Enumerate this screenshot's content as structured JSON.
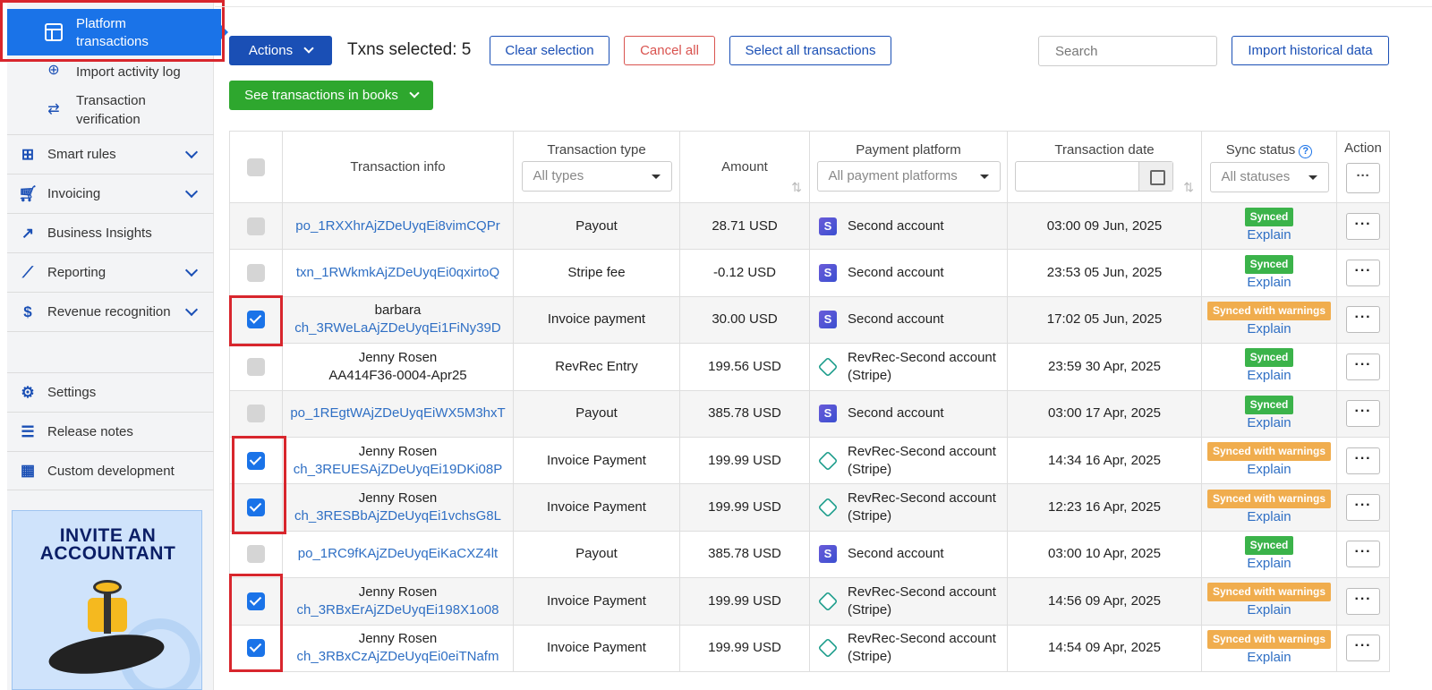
{
  "sidebar": {
    "active_item": {
      "label": "Platform transactions",
      "icon": "table-icon"
    },
    "sub_items": [
      {
        "label": "Import activity log",
        "icon": "download-circle-icon"
      },
      {
        "label": "Transaction verification",
        "icon": "arrows-exchange-icon"
      }
    ],
    "nav_items": [
      {
        "label": "Smart rules",
        "icon": "flow-icon",
        "expandable": true
      },
      {
        "label": "Invoicing",
        "icon": "cart-icon",
        "expandable": true
      },
      {
        "label": "Business Insights",
        "icon": "insights-icon",
        "expandable": false
      },
      {
        "label": "Reporting",
        "icon": "chart-line-icon",
        "expandable": true
      },
      {
        "label": "Revenue recognition",
        "icon": "dollar-icon",
        "expandable": true
      }
    ],
    "bottom_items": [
      {
        "label": "Settings",
        "icon": "gear-icon"
      },
      {
        "label": "Release notes",
        "icon": "notes-icon"
      },
      {
        "label": "Custom development",
        "icon": "grid-icon"
      }
    ],
    "promo": {
      "line1": "INVITE AN",
      "line2": "ACCOUNTANT"
    }
  },
  "toolbar": {
    "actions_label": "Actions",
    "selected_text": "Txns selected: 5",
    "clear_label": "Clear selection",
    "cancel_label": "Cancel all",
    "select_all_label": "Select all transactions",
    "search_placeholder": "Search",
    "import_label": "Import historical data",
    "books_label": "See transactions in books"
  },
  "table": {
    "headers": {
      "info": "Transaction info",
      "type": "Transaction type",
      "type_filter": "All types",
      "amount": "Amount",
      "platform": "Payment platform",
      "platform_filter": "All payment platforms",
      "date": "Transaction date",
      "sync": "Sync status",
      "sync_filter": "All statuses",
      "action": "Action"
    },
    "rows": [
      {
        "checked": false,
        "name": "",
        "id": "po_1RXXhrAjZDeUyqEi8vimCQPr",
        "type": "Payout",
        "amount": "28.71 USD",
        "platform_icon": "stripe-icon",
        "platform": "Second account",
        "date": "03:00 09 Jun, 2025",
        "status": "Synced",
        "status_kind": "ok",
        "explain": "Explain"
      },
      {
        "checked": false,
        "name": "",
        "id": "txn_1RWkmkAjZDeUyqEi0qxirtoQ",
        "type": "Stripe fee",
        "amount": "-0.12 USD",
        "platform_icon": "stripe-icon",
        "platform": "Second account",
        "date": "23:53 05 Jun, 2025",
        "status": "Synced",
        "status_kind": "ok",
        "explain": "Explain"
      },
      {
        "checked": true,
        "name": "barbara",
        "id": "ch_3RWeLaAjZDeUyqEi1FiNy39D",
        "type": "Invoice payment",
        "amount": "30.00 USD",
        "platform_icon": "stripe-icon",
        "platform": "Second account",
        "date": "17:02 05 Jun, 2025",
        "status": "Synced with warnings",
        "status_kind": "warn",
        "explain": "Explain"
      },
      {
        "checked": false,
        "name": "Jenny Rosen",
        "id": "AA414F36-0004-Apr25",
        "id_plain": true,
        "type": "RevRec Entry",
        "amount": "199.56 USD",
        "platform_icon": "revrec-icon",
        "platform": "RevRec-Second account (Stripe)",
        "date": "23:59 30 Apr, 2025",
        "status": "Synced",
        "status_kind": "ok",
        "explain": "Explain"
      },
      {
        "checked": false,
        "name": "",
        "id": "po_1REgtWAjZDeUyqEiWX5M3hxT",
        "type": "Payout",
        "amount": "385.78 USD",
        "platform_icon": "stripe-icon",
        "platform": "Second account",
        "date": "03:00 17 Apr, 2025",
        "status": "Synced",
        "status_kind": "ok",
        "explain": "Explain"
      },
      {
        "checked": true,
        "name": "Jenny Rosen",
        "id": "ch_3REUESAjZDeUyqEi19DKi08P",
        "type": "Invoice Payment",
        "amount": "199.99 USD",
        "platform_icon": "revrec-icon",
        "platform": "RevRec-Second account (Stripe)",
        "date": "14:34 16 Apr, 2025",
        "status": "Synced with warnings",
        "status_kind": "warn",
        "explain": "Explain"
      },
      {
        "checked": true,
        "name": "Jenny Rosen",
        "id": "ch_3RESBbAjZDeUyqEi1vchsG8L",
        "type": "Invoice Payment",
        "amount": "199.99 USD",
        "platform_icon": "revrec-icon",
        "platform": "RevRec-Second account (Stripe)",
        "date": "12:23 16 Apr, 2025",
        "status": "Synced with warnings",
        "status_kind": "warn",
        "explain": "Explain"
      },
      {
        "checked": false,
        "name": "",
        "id": "po_1RC9fKAjZDeUyqEiKaCXZ4lt",
        "type": "Payout",
        "amount": "385.78 USD",
        "platform_icon": "stripe-icon",
        "platform": "Second account",
        "date": "03:00 10 Apr, 2025",
        "status": "Synced",
        "status_kind": "ok",
        "explain": "Explain"
      },
      {
        "checked": true,
        "name": "Jenny Rosen",
        "id": "ch_3RBxErAjZDeUyqEi198X1o08",
        "type": "Invoice Payment",
        "amount": "199.99 USD",
        "platform_icon": "revrec-icon",
        "platform": "RevRec-Second account (Stripe)",
        "date": "14:56 09 Apr, 2025",
        "status": "Synced with warnings",
        "status_kind": "warn",
        "explain": "Explain"
      },
      {
        "checked": true,
        "name": "Jenny Rosen",
        "id": "ch_3RBxCzAjZDeUyqEi0eiTNafm",
        "type": "Invoice Payment",
        "amount": "199.99 USD",
        "platform_icon": "revrec-icon",
        "platform": "RevRec-Second account (Stripe)",
        "date": "14:54 09 Apr, 2025",
        "status": "Synced with warnings",
        "status_kind": "warn",
        "explain": "Explain"
      }
    ]
  },
  "colors": {
    "primary": "#1a4fb5",
    "active": "#1a73e8",
    "success": "#3bb34a",
    "warning": "#f0ad4e",
    "danger": "#d9534f",
    "highlight": "#d8262d"
  }
}
